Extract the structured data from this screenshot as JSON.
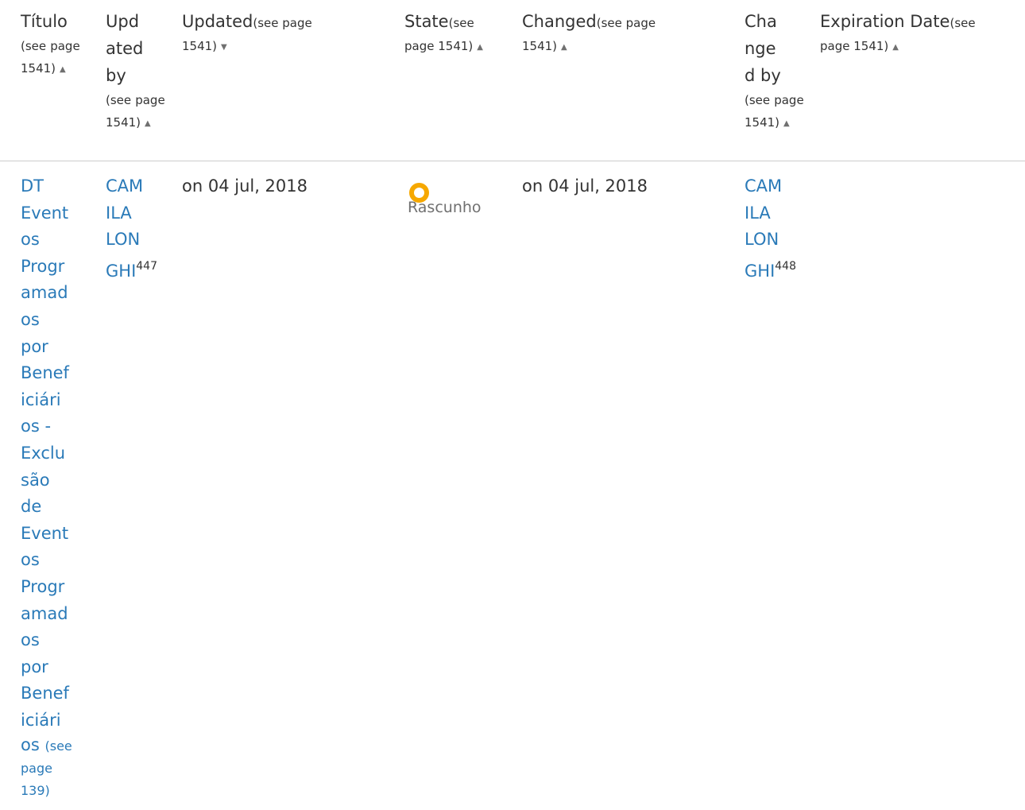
{
  "columns": [
    {
      "title_lines": [
        "Título"
      ],
      "ref_lines": [
        "(see",
        "page",
        "1541)"
      ],
      "sort": "▲"
    },
    {
      "title_lines": [
        "Upd",
        "ated",
        "by"
      ],
      "ref_lines": [
        "(see",
        "page",
        "1541)"
      ],
      "sort": "▲"
    },
    {
      "title_lines": [
        "Updated"
      ],
      "ref_lines": [
        "(see page",
        "1541)"
      ],
      "sort": "▼"
    },
    {
      "title_lines": [
        "State"
      ],
      "ref_lines": [
        "(see",
        "page 1541)"
      ],
      "sort": "▲"
    },
    {
      "title_lines": [
        "Changed"
      ],
      "ref_lines": [
        "(see page",
        "1541)"
      ],
      "sort": "▲"
    },
    {
      "title_lines": [
        "Cha",
        "nge",
        "d by"
      ],
      "ref_lines": [
        "(see",
        "page",
        "1541)"
      ],
      "sort": "▲"
    },
    {
      "title_lines": [
        "Expiration Date"
      ],
      "ref_lines": [
        "(see",
        "page 1541)"
      ],
      "sort": "▲"
    }
  ],
  "row": {
    "title_lines": [
      "DT",
      "Event",
      "os",
      "Progr",
      "amad",
      "os",
      "por",
      "Benef",
      "iciári",
      "os -",
      "Exclu",
      "são",
      "de",
      "Event",
      "os",
      "Progr",
      "amad",
      "os",
      "por",
      "Benef",
      "iciári",
      "os"
    ],
    "title_ref_lines": [
      "(see",
      "page",
      "139)"
    ],
    "updated_by_lines": [
      "CAM",
      "ILA",
      "LON",
      "GHI"
    ],
    "updated_by_footnote": "447",
    "updated": "on 04 jul, 2018",
    "state": "Rascunho",
    "state_color": "#f6a800",
    "changed": "on 04 jul, 2018",
    "changed_by_lines": [
      "CAM",
      "ILA",
      "LON",
      "GHI"
    ],
    "changed_by_footnote": "448",
    "expiration_date": ""
  },
  "colors": {
    "link": "#2a7ab8",
    "text": "#333333",
    "muted": "#707070",
    "rule": "#cccccc"
  }
}
